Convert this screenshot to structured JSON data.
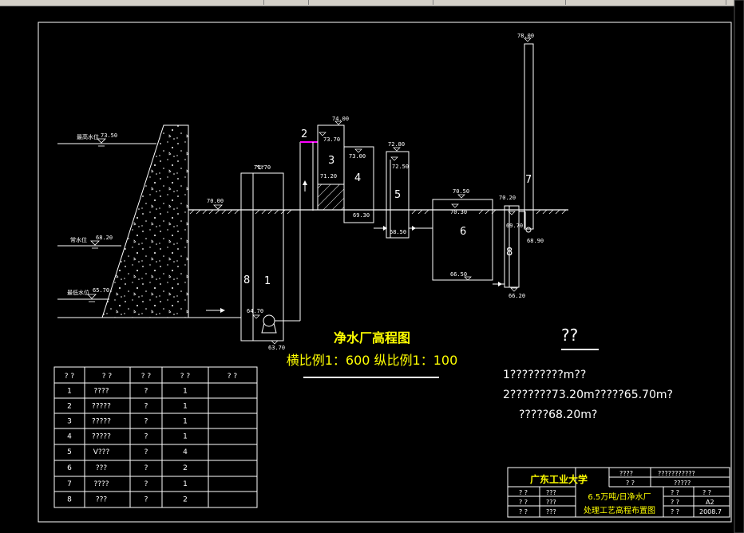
{
  "colors": {
    "background": "#000000",
    "line": "#ffffff",
    "title": "#ffff00",
    "accent": "#ff00ff"
  },
  "levels": {
    "high_water": {
      "label": "最高水位",
      "value": "73.50"
    },
    "normal_water": {
      "label": "常水位",
      "value": "68.20"
    },
    "low_water": {
      "label": "最低水位",
      "value": "65.70"
    },
    "ground": "70.00",
    "unit1_top": "71.70",
    "unit1_bottom": "63.70",
    "unit1_inlet": "64.70",
    "unit3_top": "74.00",
    "unit3_water": "73.70",
    "unit3_low": "71.20",
    "unit4_water": "73.00",
    "unit4_bottom": "69.30",
    "unit5_top": "72.80",
    "unit5_water": "72.50",
    "unit5_bottom": "68.50",
    "unit6_top": "70.50",
    "unit6_water": "70.30",
    "unit6_bottom": "66.50",
    "unit8_top": "70.20",
    "unit8_water": "69.70",
    "unit8_bottom": "66.20",
    "unit7_top": "78.00",
    "unit7_bottom": "68.90"
  },
  "units": [
    "1",
    "2",
    "3",
    "4",
    "5",
    "6",
    "7",
    "8",
    "8"
  ],
  "drawing_title": "净水厂高程图",
  "scale_text": "横比例1：600  纵比例1：100",
  "notes": {
    "heading": "??",
    "lines": [
      "1?????????m??",
      "2???????73.20m?????65.70m?",
      "?????68.20m?"
    ]
  },
  "table": {
    "headers": [
      "? ?",
      "? ?",
      "? ?",
      "? ?",
      "? ?"
    ],
    "rows": [
      [
        "1",
        "????",
        "?",
        "1",
        ""
      ],
      [
        "2",
        "?????",
        "?",
        "1",
        ""
      ],
      [
        "3",
        "?????",
        "?",
        "1",
        ""
      ],
      [
        "4",
        "?????",
        "?",
        "1",
        ""
      ],
      [
        "5",
        "V???",
        "?",
        "4",
        ""
      ],
      [
        "6",
        "???",
        "?",
        "2",
        ""
      ],
      [
        "7",
        "????",
        "?",
        "1",
        ""
      ],
      [
        "8",
        "???",
        "?",
        "2",
        ""
      ]
    ]
  },
  "title_block": {
    "school": "广东工业大学",
    "project_line1": "6.5万吨/日净水厂",
    "project_line2": "处理工艺高程布置图",
    "r1c1": "????",
    "r1c2": "???????????",
    "r2c1": "? ?",
    "r2c2": "?????",
    "l1a": "? ?",
    "l1b": "???",
    "l2a": "? ?",
    "l2b": "???",
    "l3a": "? ?",
    "l3b": "???",
    "s1a": "? ?",
    "s1b": "? ?",
    "s2a": "? ?",
    "s2b": "A2",
    "s3a": "? ?",
    "s3b": "2008.7"
  }
}
